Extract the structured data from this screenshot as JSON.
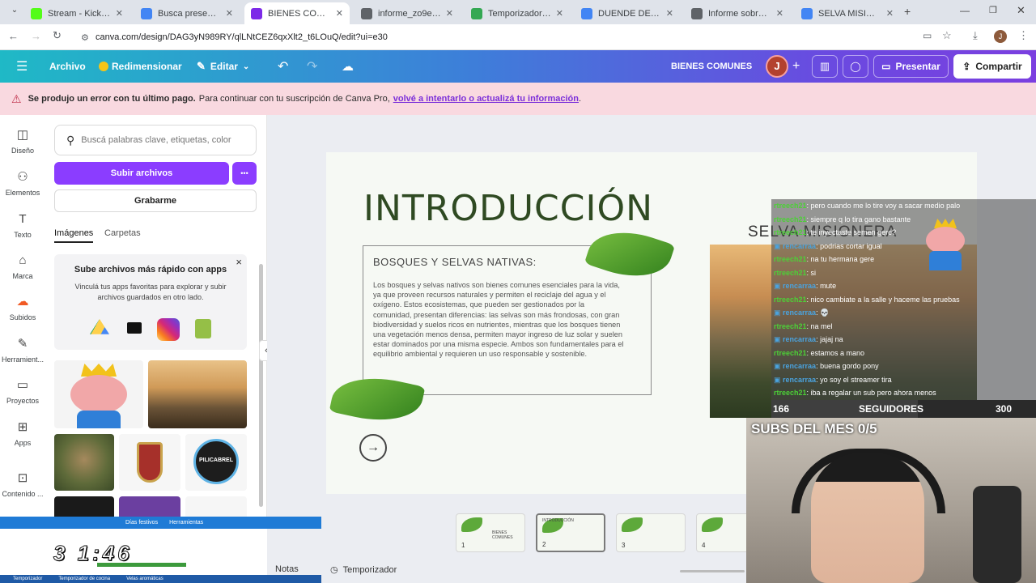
{
  "browser": {
    "tabs": [
      {
        "title": "Stream - Kick Dashb",
        "favicon": "kick",
        "color": "#53fc18"
      },
      {
        "title": "Busca presentacione",
        "favicon": "google",
        "color": "#4285f4"
      },
      {
        "title": "BIENES COMUNES",
        "favicon": "canva",
        "color": "#7d2ae8"
      },
      {
        "title": "informe_zo9eeeeee",
        "favicon": "globe",
        "color": "#5f6368"
      },
      {
        "title": "Temporizador Onlin",
        "favicon": "check",
        "color": "#34a853"
      },
      {
        "title": "DUENDE DE CLASH -",
        "favicon": "google",
        "color": "#4285f4"
      },
      {
        "title": "Informe sobre bosq",
        "favicon": "globe",
        "color": "#5f6368"
      },
      {
        "title": "SELVA MISIONERA",
        "favicon": "google",
        "color": "#4285f4"
      }
    ],
    "new_tab": "+",
    "url": "canva.com/design/DAG3yN989RY/qlLNtCEZ6qxXlt2_t6LOuQ/edit?ui=e30",
    "profile_initial": "J"
  },
  "header": {
    "menu": "☰",
    "archivo": "Archivo",
    "redimensionar": "Redimensionar",
    "editar": "Editar",
    "title": "BIENES COMUNES",
    "avatar": "J",
    "presentar": "Presentar",
    "compartir": "Compartir"
  },
  "error_banner": {
    "bold": "Se produjo un error con tu último pago.",
    "text": "Para continuar con tu suscripción de Canva Pro,",
    "link": "volvé a intentarlo o actualizá tu información",
    "tail": "."
  },
  "rail": [
    {
      "label": "Diseño",
      "icon": "layout-icon"
    },
    {
      "label": "Elementos",
      "icon": "shapes-icon"
    },
    {
      "label": "Texto",
      "icon": "text-icon"
    },
    {
      "label": "Marca",
      "icon": "brand-icon"
    },
    {
      "label": "Subidos",
      "icon": "upload-cloud-icon"
    },
    {
      "label": "Herramient...",
      "icon": "pen-tool-icon"
    },
    {
      "label": "Proyectos",
      "icon": "folder-icon"
    },
    {
      "label": "Apps",
      "icon": "apps-icon"
    },
    {
      "label": "Contenido ...",
      "icon": "content-icon"
    }
  ],
  "panel": {
    "search_placeholder": "Buscá palabras clave, etiquetas, color",
    "upload_button": "Subir archivos",
    "more": "•••",
    "record_button": "Grabarme",
    "tabs": [
      "Imágenes",
      "Carpetas"
    ],
    "promo_title": "Sube archivos más rápido con apps",
    "promo_text": "Vinculá tus apps favoritas para explorar y subir archivos guardados en otro lado.",
    "close": "×"
  },
  "slide": {
    "title": "INTRODUCCIÓN",
    "box_title": "BOSQUES Y SELVAS NATIVAS:",
    "body": "Los bosques y selvas nativos son bienes comunes esenciales para la vida, ya que proveen recursos naturales y permiten el reciclaje del agua y el oxígeno. Estos ecosistemas, que pueden ser gestionados por la comunidad, presentan diferencias: las selvas son más frondosas, con gran biodiversidad y suelos ricos en nutrientes, mientras que los bosques tienen una vegetación menos densa, permiten mayor ingreso de luz solar y suelen estar dominados por una misma especie. Ambos son fundamentales para el equilibrio ambiental y requieren un uso responsable y sostenible.",
    "side_title": "SELVA MISIONERA"
  },
  "thumbnails": [
    {
      "num": "1",
      "text": "BIENES COMUNES"
    },
    {
      "num": "2",
      "text": "INTRODUCCIÓN"
    },
    {
      "num": "3",
      "text": ""
    },
    {
      "num": "4",
      "text": ""
    }
  ],
  "bottom": {
    "notas": "Notas",
    "temporizador": "Temporizador"
  },
  "chat": [
    {
      "user": "rtreech21",
      "msg": ": pero cuando me lo tire voy a sacar medio palo",
      "badge": false
    },
    {
      "user": "rtreech21",
      "msg": ": siempre q lo tira gano bastante",
      "badge": false
    },
    {
      "user": "rtreech21",
      "msg": ": te inyectaste semen gere?",
      "badge": false
    },
    {
      "user": "rencarraa",
      "msg": ": podrias cortar igual",
      "badge": true
    },
    {
      "user": "rtreech21",
      "msg": ": na tu hermana gere",
      "badge": false
    },
    {
      "user": "rtreech21",
      "msg": ": si",
      "badge": false
    },
    {
      "user": "rencarraa",
      "msg": ": mute",
      "badge": true
    },
    {
      "user": "rtreech21",
      "msg": ": nico cambiate a la salle y haceme las pruebas",
      "badge": false
    },
    {
      "user": "rencarraa",
      "msg": ": 💀",
      "badge": true
    },
    {
      "user": "rtreech21",
      "msg": ": na mel",
      "badge": false
    },
    {
      "user": "rencarraa",
      "msg": ": jajaj na",
      "badge": true
    },
    {
      "user": "rtreech21",
      "msg": ": estamos a mano",
      "badge": false
    },
    {
      "user": "rencarraa",
      "msg": ": buena gordo pony",
      "badge": true
    },
    {
      "user": "rencarraa",
      "msg": ": yo soy el streamer tira",
      "badge": true
    },
    {
      "user": "rtreech21",
      "msg": ": iba a regalar un sub pero ahora menos",
      "badge": false
    }
  ],
  "followers": {
    "current": "166",
    "label": "SEGUIDORES",
    "goal": "300",
    "progress": 0.553
  },
  "subs": "SUBS DEL MES 0/5",
  "timer": {
    "display": "3 1:46",
    "tabs_top": [
      "Días festivos",
      "Herramientas"
    ],
    "tabs_bottom": [
      "Temporizador",
      "Temporizador de cocina",
      "Velas aromáticas"
    ]
  },
  "colors": {
    "accent": "#7d2ae8",
    "slide_title": "#2f4a22",
    "leaf": "#4e9a2b"
  }
}
